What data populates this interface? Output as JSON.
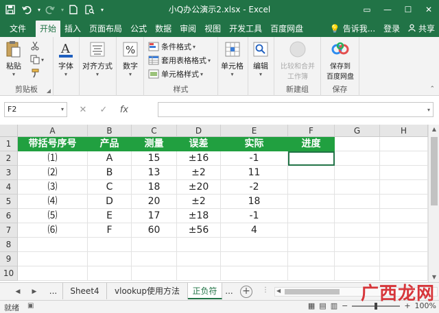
{
  "window": {
    "title": "小Q办公演示2.xlsx - Excel",
    "controls": {
      "restore": "▭",
      "minimize": "—",
      "maximize": "☐",
      "close": "✕"
    }
  },
  "quick_access": {
    "save_icon": "save-icon",
    "undo_icon": "undo-icon",
    "redo_icon": "redo-icon",
    "new_icon": "new-icon",
    "preview_icon": "print-preview-icon"
  },
  "ribbon_tabs": [
    "文件",
    "开始",
    "插入",
    "页面布局",
    "公式",
    "数据",
    "审阅",
    "视图",
    "开发工具",
    "百度网盘"
  ],
  "active_tab": "开始",
  "tell_me": "告诉我...",
  "login": "登录",
  "share": "共享",
  "ribbon": {
    "clipboard": {
      "paste": "粘贴",
      "label": "剪贴板"
    },
    "font": {
      "label": "字体"
    },
    "alignment": {
      "label": "对齐方式"
    },
    "number": {
      "label": "数字"
    },
    "styles": {
      "conditional": "条件格式",
      "table_format": "套用表格格式",
      "cell_styles": "单元格样式",
      "label": "样式"
    },
    "cells": {
      "label": "单元格"
    },
    "editing": {
      "label": "编辑"
    },
    "compare": {
      "btn_line1": "比较和合并",
      "btn_line2": "工作簿",
      "label": "新建组"
    },
    "baidu": {
      "btn_line1": "保存到",
      "btn_line2": "百度网盘",
      "label": "保存"
    }
  },
  "formula_bar": {
    "name_box": "F2",
    "cancel": "✕",
    "enter": "✓",
    "fx": "fx",
    "formula": ""
  },
  "columns": [
    "A",
    "B",
    "C",
    "D",
    "E",
    "F",
    "G",
    "H"
  ],
  "rows": [
    "1",
    "2",
    "3",
    "4",
    "5",
    "6",
    "7",
    "8",
    "9",
    "10"
  ],
  "table": {
    "headers": [
      "带括号序号",
      "产品",
      "测量",
      "误差",
      "实际",
      "进度"
    ],
    "data": [
      [
        "⑴",
        "A",
        "15",
        "±16",
        "-1",
        ""
      ],
      [
        "⑵",
        "B",
        "13",
        "±2",
        "11",
        ""
      ],
      [
        "⑶",
        "C",
        "18",
        "±20",
        "-2",
        ""
      ],
      [
        "⑷",
        "D",
        "20",
        "±2",
        "18",
        ""
      ],
      [
        "⑸",
        "E",
        "17",
        "±18",
        "-1",
        ""
      ],
      [
        "⑹",
        "F",
        "60",
        "±56",
        "4",
        ""
      ]
    ]
  },
  "sheet_tabs": {
    "ellipsis_left": "...",
    "tabs": [
      "Sheet4",
      "vlookup使用方法",
      "正负符"
    ],
    "active": "正负符",
    "ellipsis_right": "..."
  },
  "status": {
    "ready": "就绪",
    "zoom": "100%",
    "zoom_minus": "−",
    "zoom_plus": "+"
  },
  "watermark": "广西龙网",
  "colors": {
    "excel_green": "#217346",
    "header_fill": "#21a040"
  }
}
